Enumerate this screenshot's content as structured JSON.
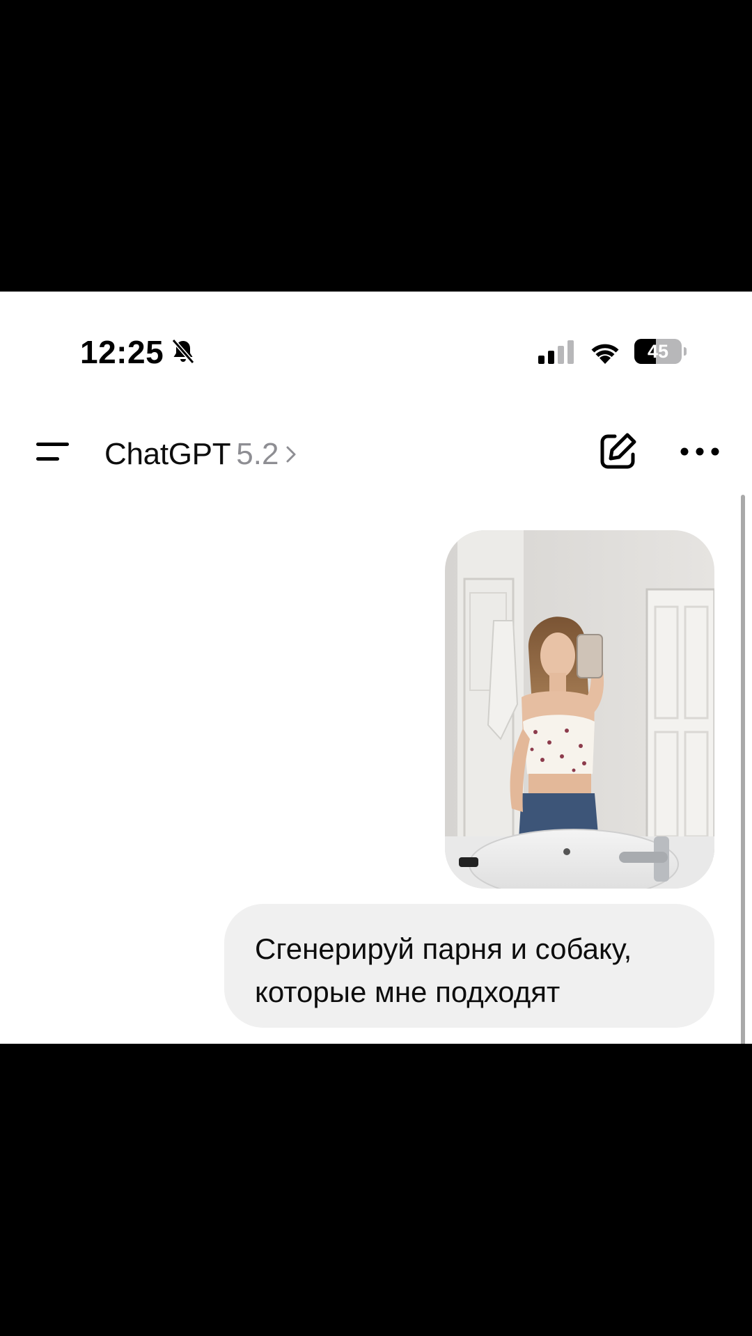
{
  "status_bar": {
    "time": "12:25",
    "silent_icon": "bell-slash-icon",
    "signal_icon": "cellular-signal-icon",
    "wifi_icon": "wifi-icon",
    "battery_level": "45",
    "battery_fraction": 0.45
  },
  "header": {
    "menu_icon": "menu-icon",
    "title": "ChatGPT",
    "version": "5.2",
    "chevron_icon": "chevron-right-icon",
    "new_chat_icon": "compose-icon",
    "more_icon": "ellipsis-icon"
  },
  "conversation": {
    "messages": [
      {
        "role": "user",
        "type": "image",
        "image": "mirror-selfie-photo"
      },
      {
        "role": "user",
        "type": "text",
        "text": "Сгенерируй парня и собаку, которые мне подходят"
      }
    ]
  },
  "colors": {
    "background": "#ffffff",
    "bubble": "#f0f0f0",
    "text": "#0d0d0d",
    "muted": "#8e8e93"
  }
}
